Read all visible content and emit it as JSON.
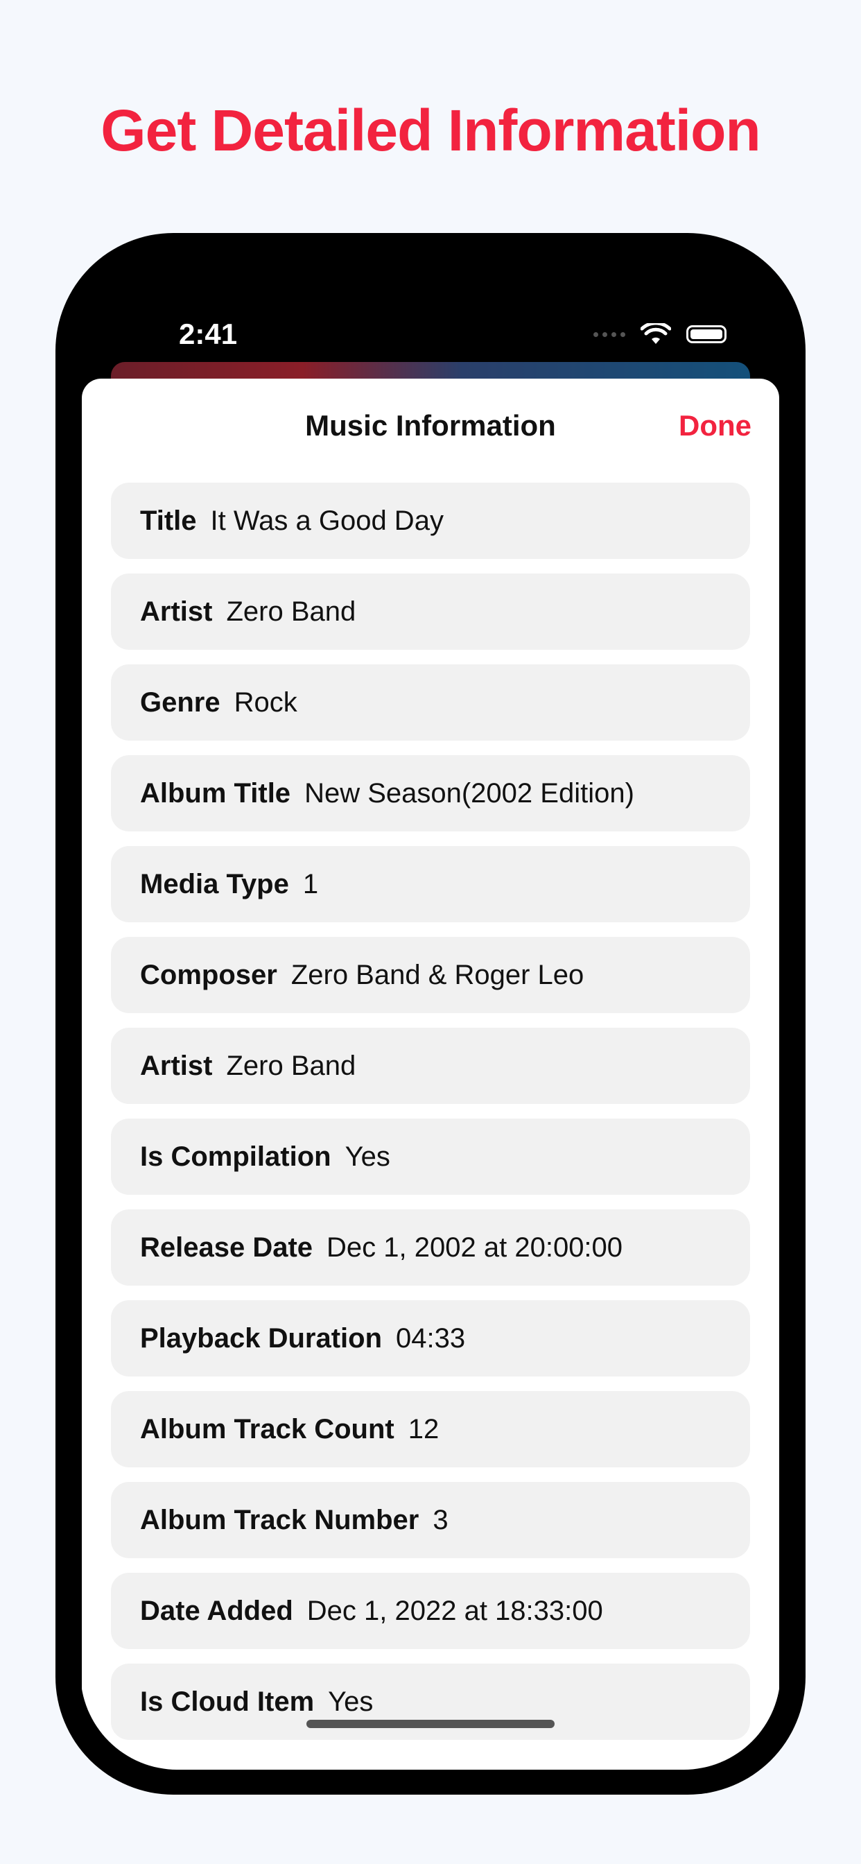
{
  "headline": "Get Detailed Information",
  "status_bar": {
    "time": "2:41",
    "icons": [
      "signal-icon",
      "wifi-icon",
      "battery-icon"
    ]
  },
  "sheet": {
    "title": "Music Information",
    "done_label": "Done",
    "rows": [
      {
        "label": "Title",
        "value": "It Was a Good Day"
      },
      {
        "label": "Artist",
        "value": "Zero Band"
      },
      {
        "label": "Genre",
        "value": "Rock"
      },
      {
        "label": "Album Title",
        "value": "New Season(2002 Edition)"
      },
      {
        "label": "Media Type",
        "value": "1"
      },
      {
        "label": "Composer",
        "value": "Zero Band & Roger Leo"
      },
      {
        "label": "Artist",
        "value": "Zero Band"
      },
      {
        "label": "Is Compilation",
        "value": "Yes"
      },
      {
        "label": "Release Date",
        "value": "Dec 1, 2002 at 20:00:00"
      },
      {
        "label": "Playback Duration",
        "value": "04:33"
      },
      {
        "label": "Album Track Count",
        "value": "12"
      },
      {
        "label": "Album Track Number",
        "value": "3"
      },
      {
        "label": "Date Added",
        "value": "Dec 1, 2022 at 18:33:00"
      },
      {
        "label": "Is Cloud Item",
        "value": "Yes"
      }
    ]
  },
  "colors": {
    "accent": "#f2233f",
    "background": "#f5f8fd",
    "row_background": "#f1f1f1"
  }
}
